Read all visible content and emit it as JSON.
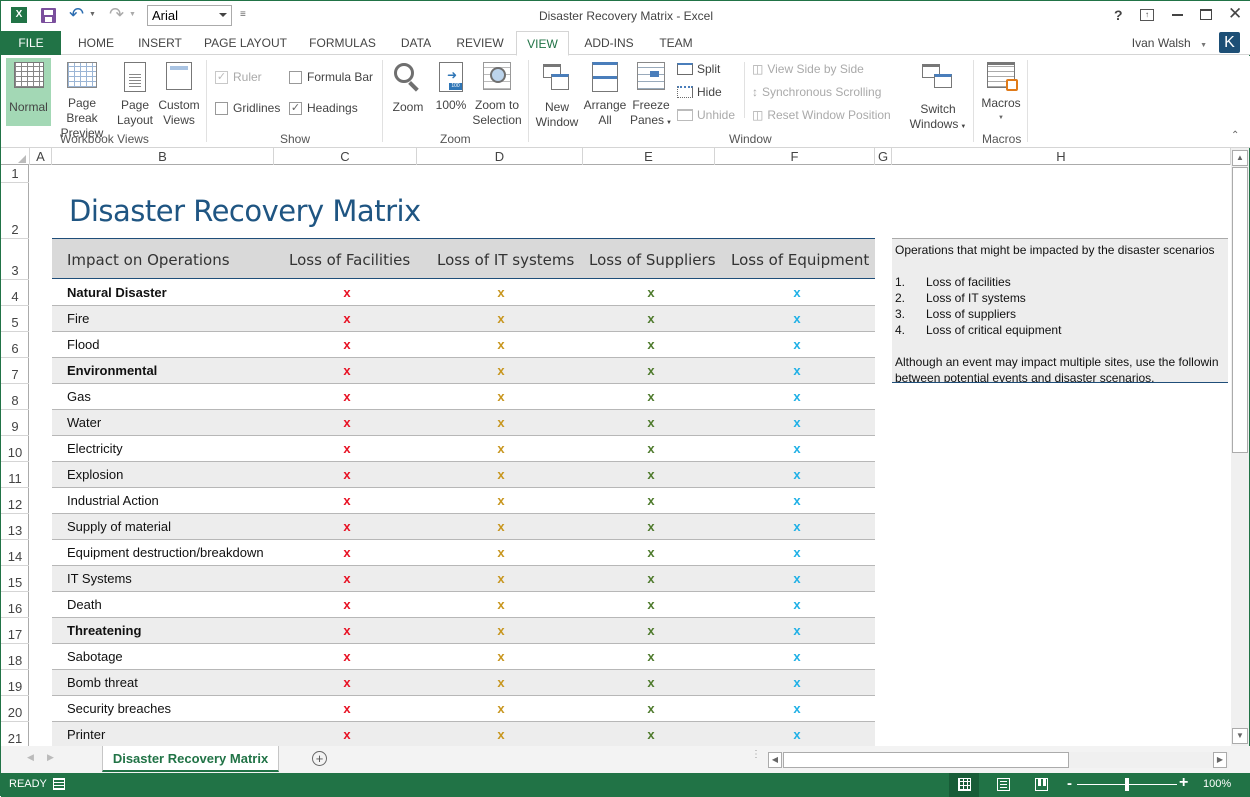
{
  "app": {
    "window_title": "Disaster Recovery Matrix - Excel",
    "font_name": "Arial",
    "user_name": "Ivan Walsh",
    "user_initial": "K",
    "help": "?",
    "accent_color": "#217346"
  },
  "tabs": [
    "FILE",
    "HOME",
    "INSERT",
    "PAGE LAYOUT",
    "FORMULAS",
    "DATA",
    "REVIEW",
    "VIEW",
    "ADD-INS",
    "TEAM"
  ],
  "active_tab": "VIEW",
  "ribbon": {
    "workbook_views": {
      "label": "Workbook Views",
      "normal": "Normal",
      "page_break_1": "Page Break",
      "page_break_2": "Preview",
      "page_layout_1": "Page",
      "page_layout_2": "Layout",
      "custom_views_1": "Custom",
      "custom_views_2": "Views"
    },
    "show": {
      "label": "Show",
      "ruler": "Ruler",
      "formula_bar": "Formula Bar",
      "gridlines": "Gridlines",
      "headings": "Headings",
      "ruler_checked": true,
      "formula_bar_checked": false,
      "gridlines_checked": false,
      "headings_checked": true
    },
    "zoom": {
      "label": "Zoom",
      "zoom": "Zoom",
      "hundred": "100%",
      "zoom_sel_1": "Zoom to",
      "zoom_sel_2": "Selection"
    },
    "window": {
      "label": "Window",
      "new_window_1": "New",
      "new_window_2": "Window",
      "arrange_1": "Arrange",
      "arrange_2": "All",
      "freeze_1": "Freeze",
      "freeze_2": "Panes",
      "split": "Split",
      "hide": "Hide",
      "unhide": "Unhide",
      "side_by_side": "View Side by Side",
      "sync_scroll": "Synchronous Scrolling",
      "reset_pos": "Reset Window Position",
      "switch_1": "Switch",
      "switch_2": "Windows"
    },
    "macros": {
      "label": "Macros",
      "macros": "Macros"
    }
  },
  "grid": {
    "columns": [
      "A",
      "B",
      "C",
      "D",
      "E",
      "F",
      "G",
      "H"
    ],
    "rows": [
      "1",
      "2",
      "3",
      "4",
      "5",
      "6",
      "7",
      "8",
      "9",
      "10",
      "11",
      "12",
      "13",
      "14",
      "15",
      "16",
      "17",
      "18",
      "19",
      "20",
      "21"
    ]
  },
  "sheet": {
    "title": "Disaster Recovery Matrix",
    "headers": [
      "Impact on Operations",
      "Loss of Facilities",
      "Loss of IT systems",
      "Loss of Suppliers",
      "Loss of Equipment"
    ],
    "mark_colors": [
      "#e81123",
      "#c8961e",
      "#4e7a2c",
      "#1fb0e6"
    ],
    "rows": [
      {
        "label": "Natural Disaster",
        "bold": true,
        "marks": [
          "x",
          "x",
          "x",
          "x"
        ]
      },
      {
        "label": "Fire",
        "bold": false,
        "marks": [
          "x",
          "x",
          "x",
          "x"
        ]
      },
      {
        "label": "Flood",
        "bold": false,
        "marks": [
          "x",
          "x",
          "x",
          "x"
        ]
      },
      {
        "label": "Environmental",
        "bold": true,
        "marks": [
          "x",
          "x",
          "x",
          "x"
        ]
      },
      {
        "label": "Gas",
        "bold": false,
        "marks": [
          "x",
          "x",
          "x",
          "x"
        ]
      },
      {
        "label": "Water",
        "bold": false,
        "marks": [
          "x",
          "x",
          "x",
          "x"
        ]
      },
      {
        "label": "Electricity",
        "bold": false,
        "marks": [
          "x",
          "x",
          "x",
          "x"
        ]
      },
      {
        "label": "Explosion",
        "bold": false,
        "marks": [
          "x",
          "x",
          "x",
          "x"
        ]
      },
      {
        "label": "Industrial Action",
        "bold": false,
        "marks": [
          "x",
          "x",
          "x",
          "x"
        ]
      },
      {
        "label": "Supply of material",
        "bold": false,
        "marks": [
          "x",
          "x",
          "x",
          "x"
        ]
      },
      {
        "label": "Equipment destruction/breakdown",
        "bold": false,
        "marks": [
          "x",
          "x",
          "x",
          "x"
        ]
      },
      {
        "label": "IT Systems",
        "bold": false,
        "marks": [
          "x",
          "x",
          "x",
          "x"
        ]
      },
      {
        "label": "Death",
        "bold": false,
        "marks": [
          "x",
          "x",
          "x",
          "x"
        ]
      },
      {
        "label": "Threatening",
        "bold": true,
        "marks": [
          "x",
          "x",
          "x",
          "x"
        ]
      },
      {
        "label": "Sabotage",
        "bold": false,
        "marks": [
          "x",
          "x",
          "x",
          "x"
        ]
      },
      {
        "label": "Bomb threat",
        "bold": false,
        "marks": [
          "x",
          "x",
          "x",
          "x"
        ]
      },
      {
        "label": "Security breaches",
        "bold": false,
        "marks": [
          "x",
          "x",
          "x",
          "x"
        ]
      },
      {
        "label": "Printer",
        "bold": false,
        "marks": [
          "x",
          "x",
          "x",
          "x"
        ]
      }
    ],
    "note": {
      "intro": "Operations that might be impacted by the disaster scenarios",
      "items": [
        {
          "n": "1.",
          "text": "Loss of facilities"
        },
        {
          "n": "2.",
          "text": "Loss of IT systems"
        },
        {
          "n": "3.",
          "text": "Loss of suppliers"
        },
        {
          "n": "4.",
          "text": "Loss of critical equipment"
        }
      ],
      "line1": "Although an event may impact multiple sites, use the followin",
      "line2": "between potential events and disaster scenarios."
    }
  },
  "sheet_tabs": [
    "Disaster Recovery Matrix"
  ],
  "status": {
    "state": "READY",
    "zoom": "100%",
    "zoom_minus": "-",
    "zoom_plus": "+"
  }
}
